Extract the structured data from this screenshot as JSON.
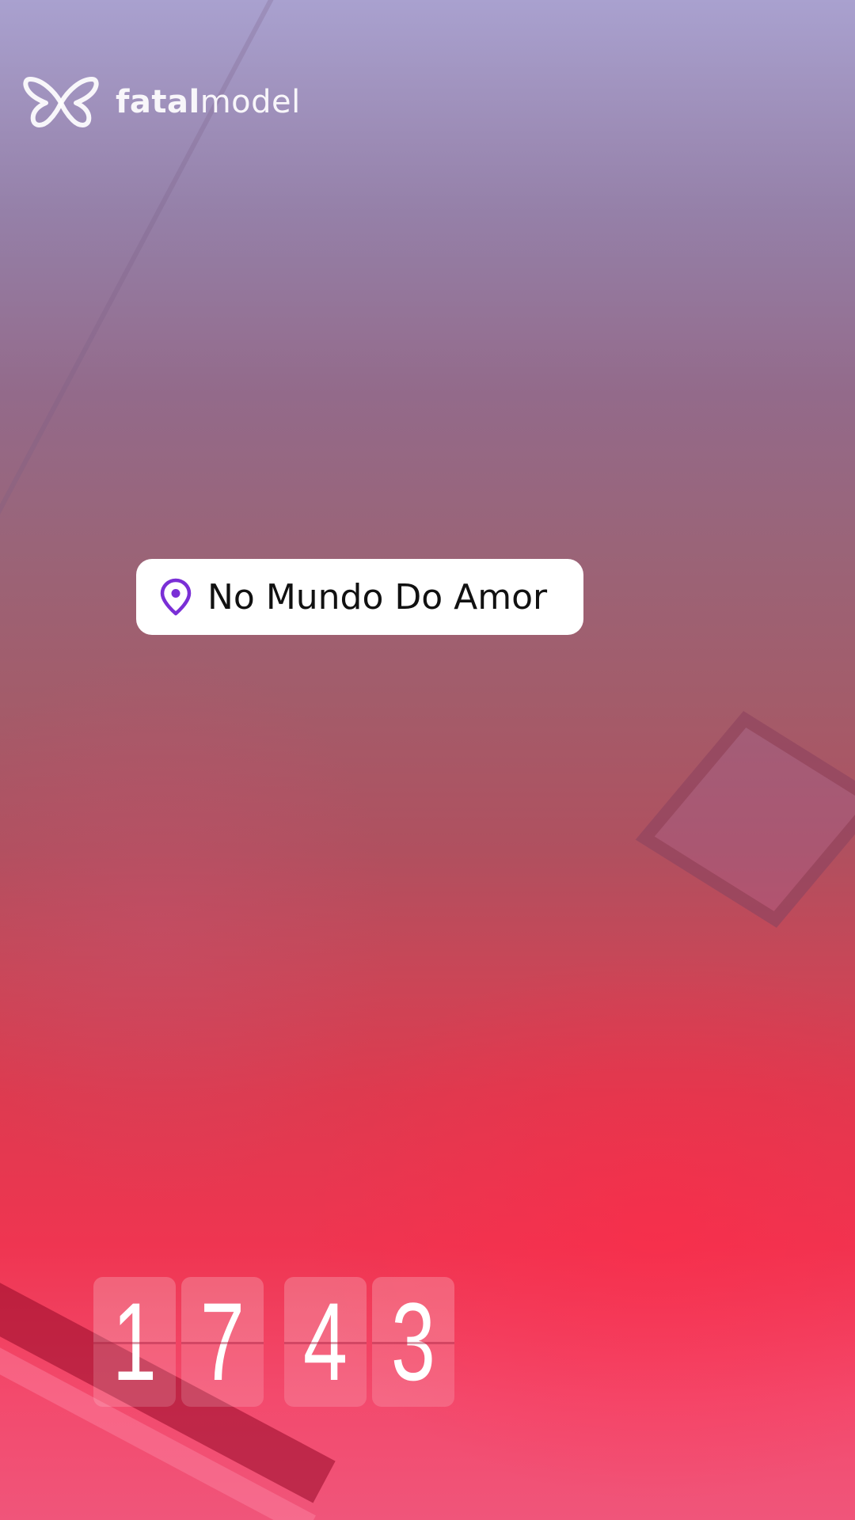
{
  "brand": {
    "name_bold": "fatal",
    "name_light": "model",
    "logo_icon": "butterfly-icon"
  },
  "location_sticker": {
    "icon": "map-pin-icon",
    "label": "No Mundo Do Amor",
    "pin_color": "#7a2fd6"
  },
  "clock": {
    "digits": [
      "1",
      "7",
      "4",
      "3"
    ]
  },
  "colors": {
    "top": "#a9a1cf",
    "bottom": "#f34a6d"
  }
}
